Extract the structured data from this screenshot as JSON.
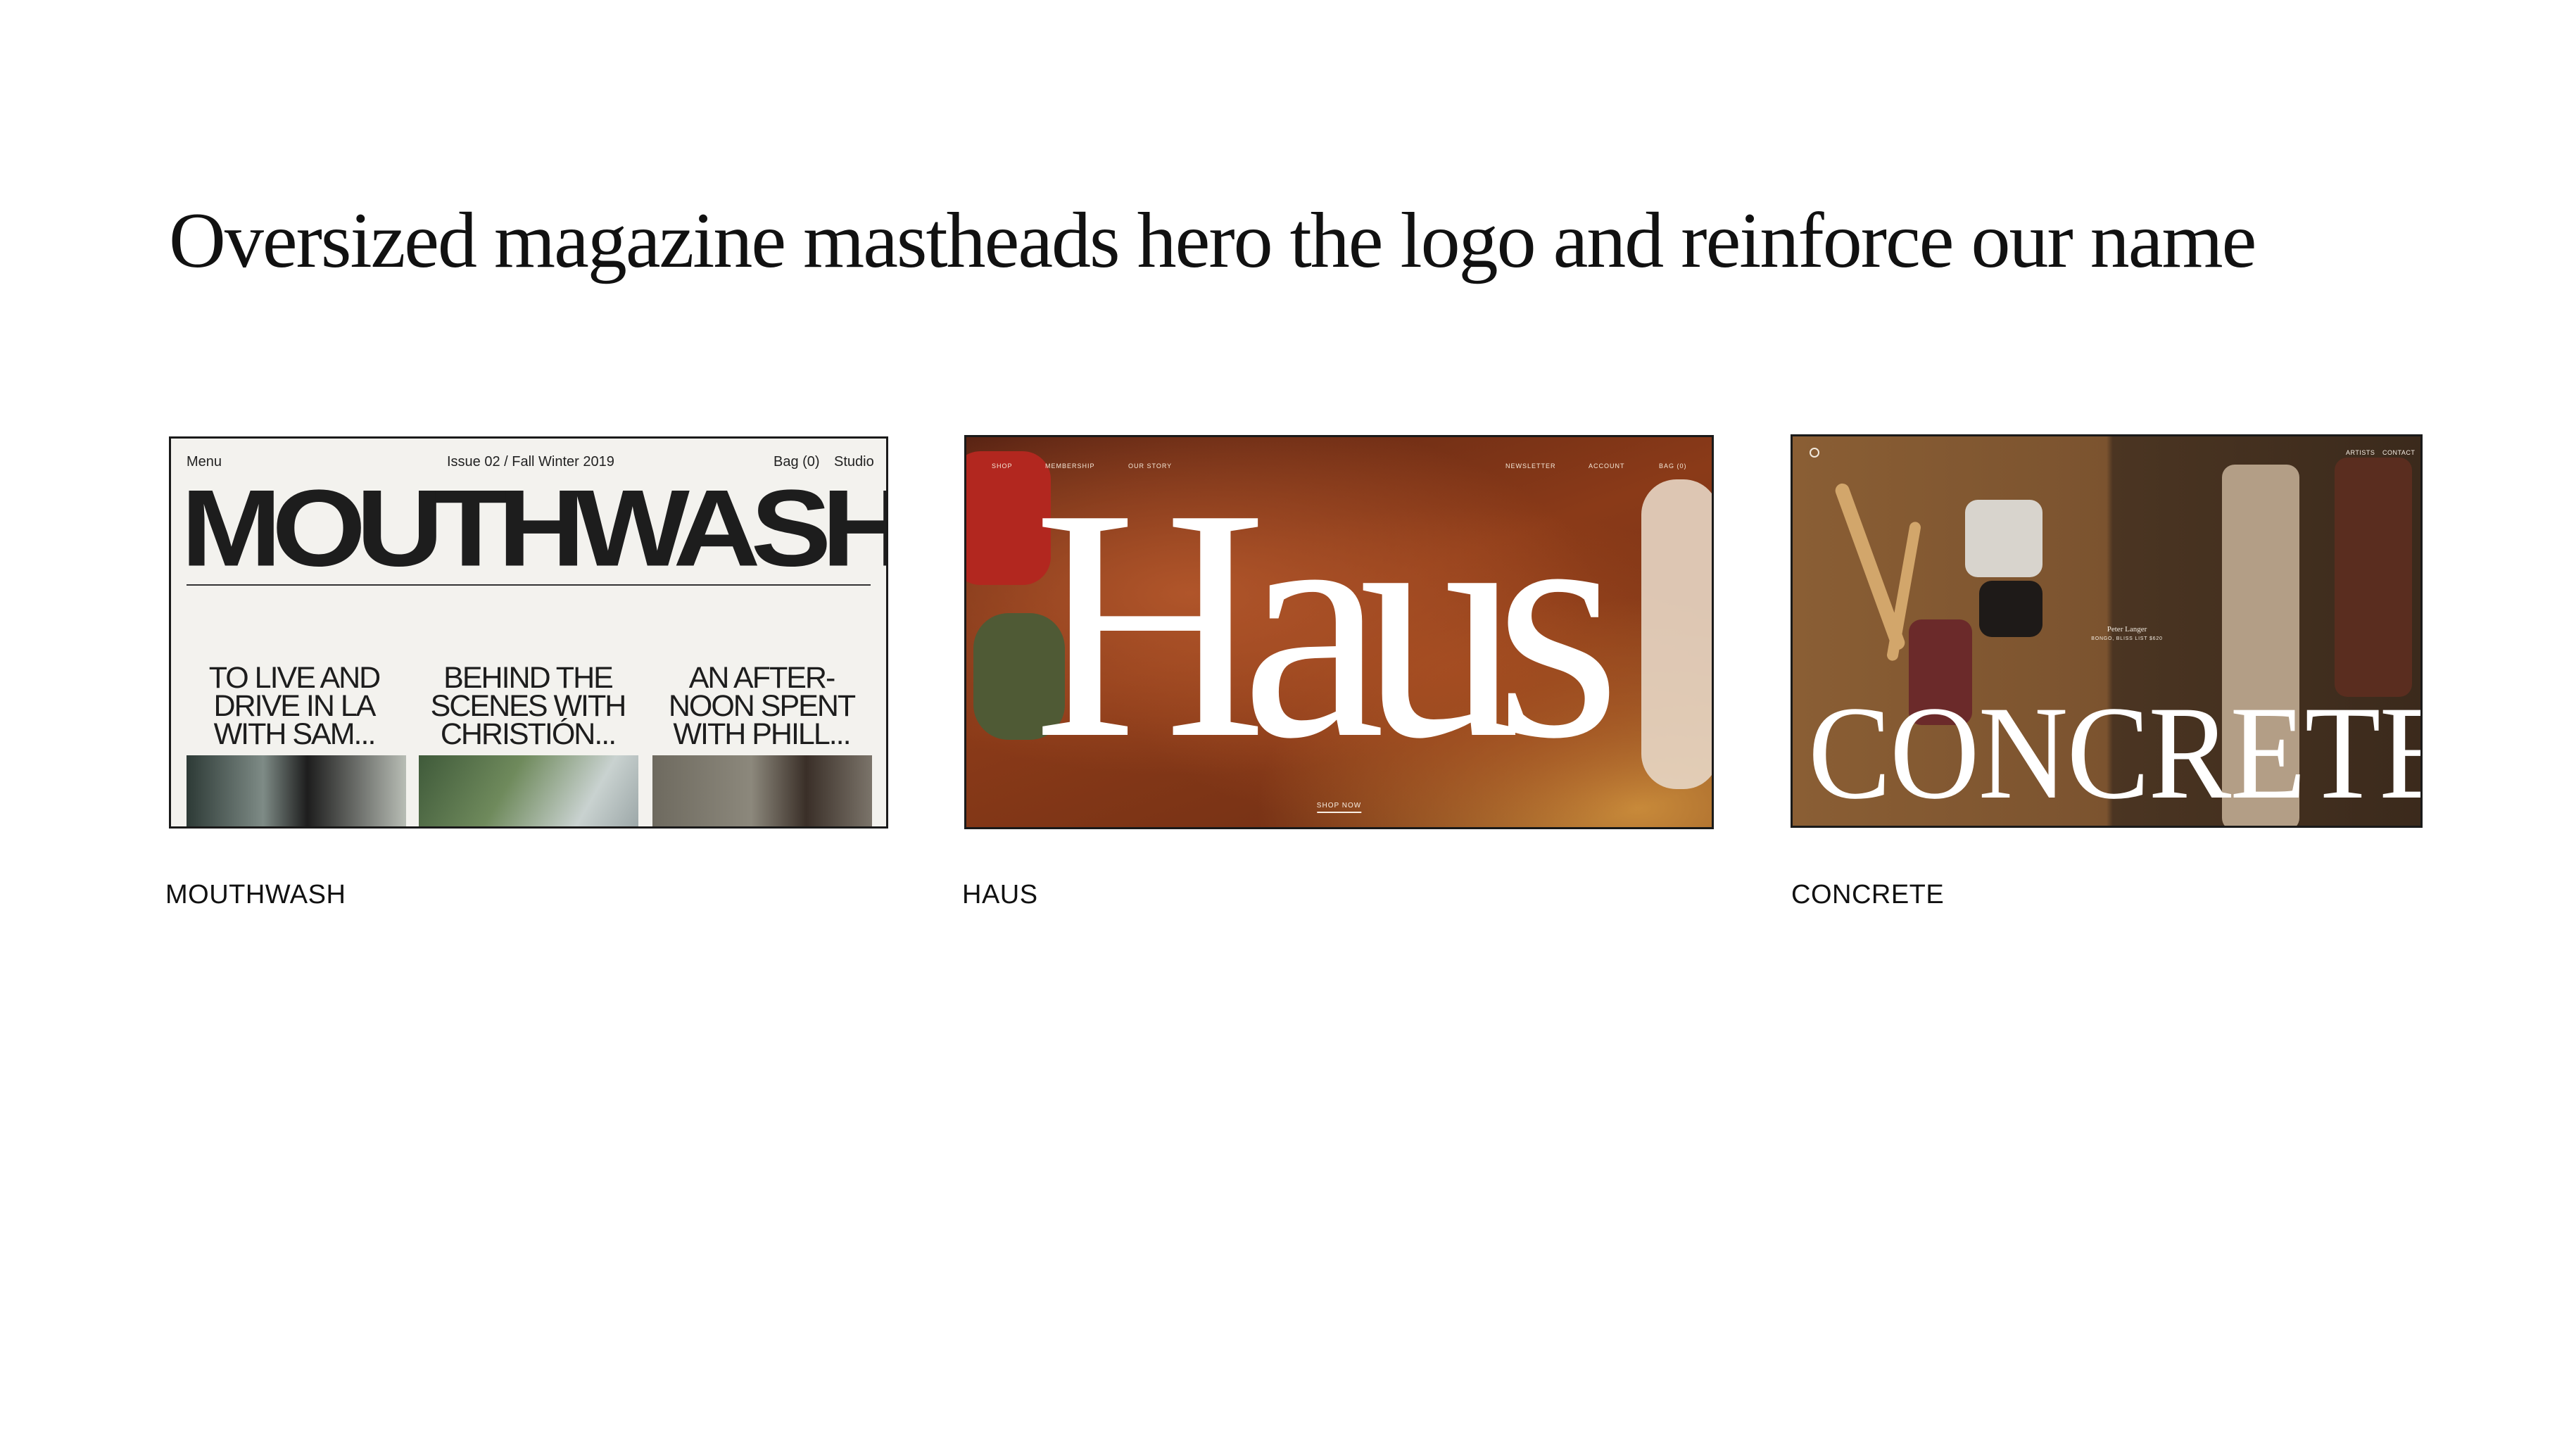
{
  "heading": "Oversized magazine mastheads hero the logo and reinforce our name",
  "cards": [
    {
      "caption": "MOUTHWASH",
      "nav": {
        "menu": "Menu",
        "issue": "Issue 02 / Fall Winter 2019",
        "bag": "Bag (0)",
        "studio": "Studio"
      },
      "logo": "MOUTHWASH",
      "stories": [
        "TO LIVE AND DRIVE IN LA WITH SAM...",
        "BEHIND THE SCENES WITH CHRISTIÓN...",
        "AN AFTER-NOON SPENT WITH PHILL..."
      ]
    },
    {
      "caption": "HAUS",
      "nav": [
        "SHOP",
        "MEMBERSHIP",
        "OUR STORY",
        "NEWSLETTER",
        "ACCOUNT",
        "BAG (0)"
      ],
      "logo": "Haus",
      "cta": "SHOP NOW"
    },
    {
      "caption": "CONCRETE",
      "nav": [
        "ARTISTS",
        "CONTACT"
      ],
      "artwork_title": "Peter Langer",
      "artwork_subtitle": "BONGO, BLISS LIST $620",
      "logo": "CONCRETE"
    }
  ],
  "colors": {
    "background": "#ffffff",
    "mouthwash_bg": "#f3f2ee",
    "haus_wood": "#8a3a18",
    "concrete_wall": "#7b532f"
  }
}
